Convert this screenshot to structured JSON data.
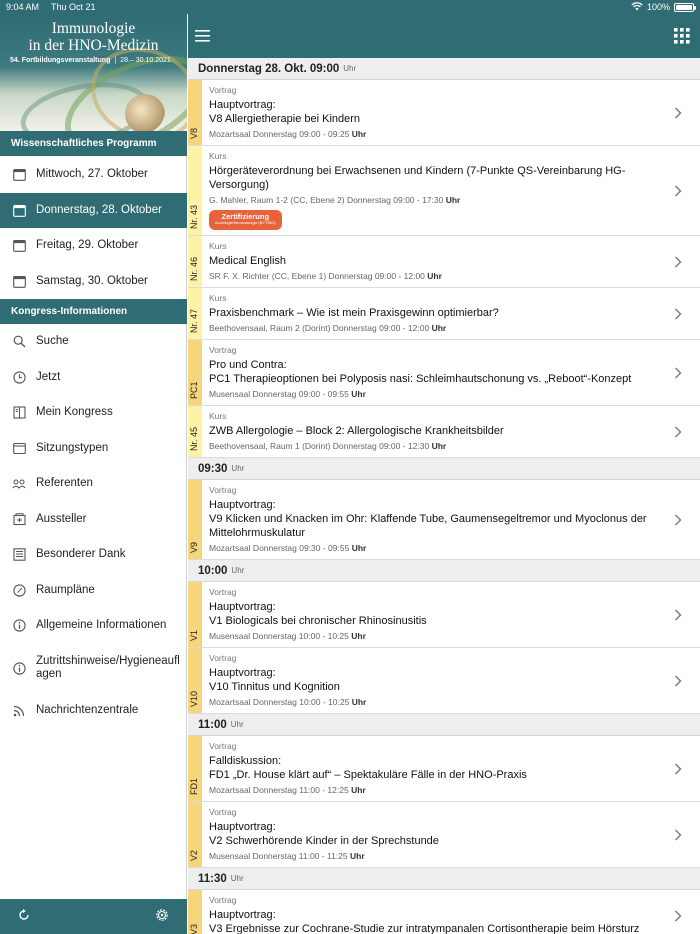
{
  "status_bar": {
    "time": "9:04 AM",
    "date": "Thu Oct 21",
    "battery": "100%",
    "battery_level": 1.0
  },
  "banner": {
    "title_line1": "Immunologie",
    "title_line2": "in der HNO-Medizin",
    "event": "54. Fortbildungsveranstaltung",
    "dates": "28.– 30.10.2021"
  },
  "sidebar": {
    "section_program": "Wissenschaftliches Programm",
    "days": [
      {
        "label": "Mittwoch, 27. Oktober",
        "icon": "calendar-icon"
      },
      {
        "label": "Donnerstag, 28. Oktober",
        "icon": "calendar-icon"
      },
      {
        "label": "Freitag, 29. Oktober",
        "icon": "calendar-icon"
      },
      {
        "label": "Samstag, 30. Oktober",
        "icon": "calendar-icon"
      }
    ],
    "active_day": "Donnerstag, 28. Oktober",
    "section_info": "Kongress-Informationen",
    "info_items": [
      {
        "label": "Suche",
        "icon": "search-icon"
      },
      {
        "label": "Jetzt",
        "icon": "clock-icon"
      },
      {
        "label": "Mein Kongress",
        "icon": "bookmark-book-icon"
      },
      {
        "label": "Sitzungstypen",
        "icon": "window-icon"
      },
      {
        "label": "Referenten",
        "icon": "speakers-icon"
      },
      {
        "label": "Aussteller",
        "icon": "exhibitor-icon"
      },
      {
        "label": "Besonderer Dank",
        "icon": "list-icon"
      },
      {
        "label": "Raumpläne",
        "icon": "compass-icon"
      },
      {
        "label": "Allgemeine Informationen",
        "icon": "info-icon"
      },
      {
        "label": "Zutrittshinweise/Hygieneauflagen",
        "icon": "info-icon"
      },
      {
        "label": "Nachrichtenzentrale",
        "icon": "rss-icon"
      }
    ],
    "footer_icons": [
      "refresh-icon",
      "settings-gear-icon"
    ]
  },
  "toolbar": {
    "left_icon": "hamburger-menu-icon",
    "right_icon": "grid-apps-icon"
  },
  "schedule": {
    "uhr": "Uhr",
    "groups": [
      {
        "time": "Donnerstag 28. Okt. 09:00",
        "sessions": [
          {
            "code": "V8",
            "type": "Vortrag",
            "title": "Hauptvortrag:\nV8 Allergietherapie bei Kindern",
            "room": "Mozartsaal Donnerstag 09:00 - 09:25",
            "kind": "vortrag"
          },
          {
            "code": "Nr. 43",
            "type": "Kurs",
            "title": "Hörgeräteverordnung bei Erwachsenen und Kindern (7-Punkte QS-Vereinbarung HG-Versorgung)",
            "room": "G. Mahler, Raum 1-2 (CC, Ebene 2) Donnerstag 09:00 - 17:30",
            "kind": "kurs",
            "badge": "Zertifizierung",
            "badge_sub": "Audiologie/Neurootologie (BV HNO)"
          },
          {
            "code": "Nr. 46",
            "type": "Kurs",
            "title": "Medical English",
            "room": "SR F. X. Richter (CC, Ebene 1) Donnerstag 09:00 - 12:00",
            "kind": "kurs"
          },
          {
            "code": "Nr. 47",
            "type": "Kurs",
            "title": "Praxisbenchmark – Wie ist mein Praxisgewinn optimierbar?",
            "room": "Beethovensaal, Raum 2 (Dorint) Donnerstag 09:00 - 12:00",
            "kind": "kurs"
          },
          {
            "code": "PC1",
            "type": "Vortrag",
            "title": "Pro und Contra:\nPC1 Therapieoptionen bei Polyposis nasi: Schleimhautschonung vs. „Reboot“-Konzept",
            "room": "Musensaal Donnerstag 09:00 - 09:55",
            "kind": "vortrag"
          },
          {
            "code": "Nr. 45",
            "type": "Kurs",
            "title": "ZWB Allergologie – Block 2: Allergologische Krankheitsbilder",
            "room": "Beethovensaal, Raum 1 (Dorint) Donnerstag 09:00 - 12:30",
            "kind": "kurs"
          }
        ]
      },
      {
        "time": "09:30",
        "sessions": [
          {
            "code": "V9",
            "type": "Vortrag",
            "title": "Hauptvortrag:\nV9 Klicken und Knacken im Ohr: Klaffende Tube, Gaumensegeltremor und Myoclonus der Mittelohrmuskulatur",
            "room": "Mozartsaal Donnerstag 09:30 - 09:55",
            "kind": "vortrag"
          }
        ]
      },
      {
        "time": "10:00",
        "sessions": [
          {
            "code": "V1",
            "type": "Vortrag",
            "title": "Hauptvortrag:\nV1 Biologicals bei chronischer Rhinosinusitis",
            "room": "Musensaal Donnerstag 10:00 - 10:25",
            "kind": "vortrag"
          },
          {
            "code": "V10",
            "type": "Vortrag",
            "title": "Hauptvortrag:\nV10 Tinnitus und Kognition",
            "room": "Mozartsaal Donnerstag 10:00 - 10:25",
            "kind": "vortrag"
          }
        ]
      },
      {
        "time": "11:00",
        "sessions": [
          {
            "code": "FD1",
            "type": "Vortrag",
            "title": "Falldiskussion:\nFD1 „Dr. House klärt auf“ – Spektakuläre Fälle in der HNO-Praxis",
            "room": "Mozartsaal Donnerstag 11:00 - 12:25",
            "kind": "vortrag"
          },
          {
            "code": "V2",
            "type": "Vortrag",
            "title": "Hauptvortrag:\nV2 Schwerhörende Kinder in der Sprechstunde",
            "room": "Musensaal Donnerstag 11:00 - 11:25",
            "kind": "vortrag"
          }
        ]
      },
      {
        "time": "11:30",
        "sessions": [
          {
            "code": "V3",
            "type": "Vortrag",
            "title": "Hauptvortrag:\nV3 Ergebnisse zur Cochrane-Studie zur intratympanalen Cortisontherapie beim Hörsturz",
            "room": "",
            "kind": "vortrag"
          }
        ]
      }
    ]
  }
}
